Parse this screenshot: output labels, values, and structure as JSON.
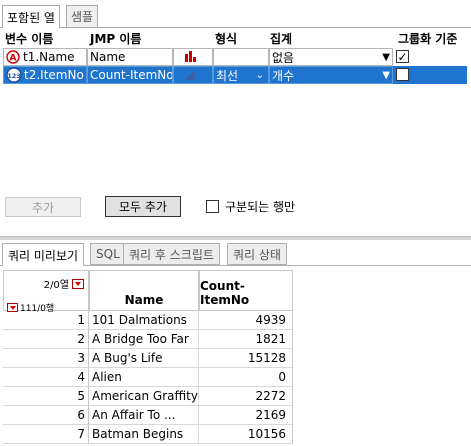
{
  "top_tabs": [
    "포함된 열",
    "샘플"
  ],
  "columns_grid": {
    "headers": [
      "변수 이름",
      "JMP 이름",
      "형식",
      "집계",
      "그룹화 기준"
    ],
    "rows": [
      {
        "var": "t1.Name",
        "jmp": "Name",
        "format": "",
        "agg": "없음",
        "group_checked": "✓",
        "icon": "A",
        "type_icon": "bar-chart-icon"
      },
      {
        "var": "t2.ItemNo",
        "jmp": "Count-ItemNo",
        "format": "최선",
        "agg": "개수",
        "group_checked": "",
        "icon": "123",
        "type_icon": "triangle-icon"
      }
    ]
  },
  "buttons": {
    "add": "추가",
    "add_all": "모두 추가",
    "distinct_rows": "구분되는 행만"
  },
  "bottom_tabs": [
    "쿼리 미리보기",
    "SQL",
    "쿼리 후 스크립트",
    "쿼리 상태"
  ],
  "preview": {
    "cols_info": "2/0열",
    "rows_info": "111/0행",
    "headers": [
      "Name",
      "Count-ItemNo"
    ],
    "rows": [
      {
        "n": "1",
        "name": "101 Dalmations",
        "count": "4939"
      },
      {
        "n": "2",
        "name": "A Bridge Too Far",
        "count": "1821"
      },
      {
        "n": "3",
        "name": "A Bug's Life",
        "count": "15128"
      },
      {
        "n": "4",
        "name": "Alien",
        "count": "0"
      },
      {
        "n": "5",
        "name": "American Graffity",
        "count": "2272"
      },
      {
        "n": "6",
        "name": "An Affair To ...",
        "count": "2169"
      },
      {
        "n": "7",
        "name": "Batman Begins",
        "count": "10156"
      }
    ]
  },
  "colors": {
    "selection": "#1f74cf",
    "accent_red": "#d00000"
  }
}
